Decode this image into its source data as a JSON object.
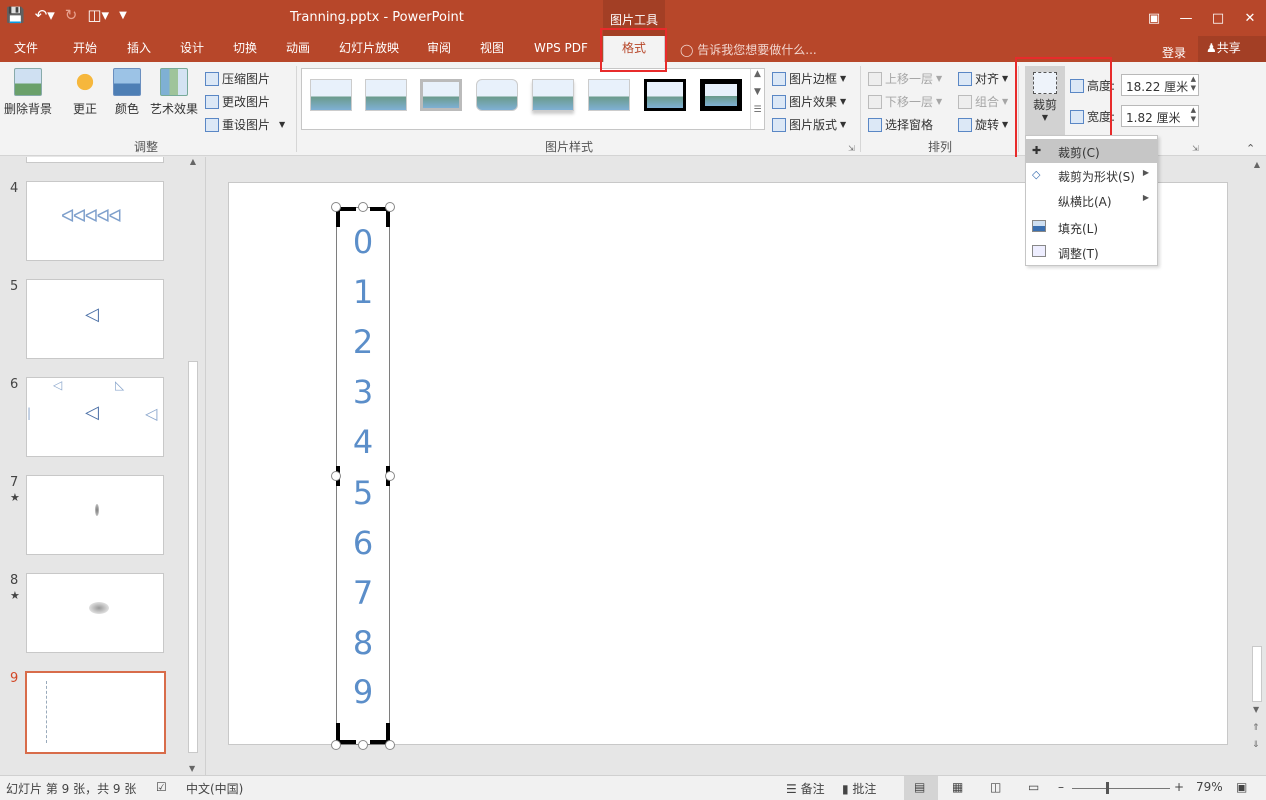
{
  "titlebar": {
    "doc_title": "Tranning.pptx - PowerPoint",
    "context_group": "图片工具",
    "qat_icons": [
      "save-icon",
      "undo-icon",
      "redo-icon",
      "present-icon",
      "customize-icon"
    ],
    "window_controls": [
      "ribbon-display-icon",
      "minimize-icon",
      "maximize-icon",
      "close-icon"
    ]
  },
  "tabs": [
    "文件",
    "开始",
    "插入",
    "设计",
    "切换",
    "动画",
    "幻灯片放映",
    "审阅",
    "视图",
    "WPS PDF",
    "格式"
  ],
  "tell_me": "告诉我您想要做什么...",
  "login": "登录",
  "share": "共享",
  "ribbon": {
    "adjust": {
      "remove_bg": "删除背景",
      "corrections": "更正",
      "color": "颜色",
      "artistic": "艺术效果",
      "compress": "压缩图片",
      "change": "更改图片",
      "reset": "重设图片",
      "label": "调整"
    },
    "styles": {
      "border": "图片边框",
      "effects": "图片效果",
      "layout": "图片版式",
      "label": "图片样式"
    },
    "arrange": {
      "bring_forward": "上移一层",
      "send_backward": "下移一层",
      "selection_pane": "选择窗格",
      "align": "对齐",
      "group": "组合",
      "rotate": "旋转",
      "label": "排列"
    },
    "size": {
      "crop": "裁剪",
      "height_label": "高度:",
      "height_value": "18.22 厘米",
      "width_label": "宽度:",
      "width_value": "1.82 厘米"
    }
  },
  "crop_menu": [
    {
      "label": "裁剪(C)",
      "icon": "crop-icon",
      "submenu": false,
      "highlighted": true
    },
    {
      "label": "裁剪为形状(S)",
      "icon": "crop-shape-icon",
      "submenu": true,
      "highlighted": false
    },
    {
      "label": "纵横比(A)",
      "icon": "",
      "submenu": true,
      "highlighted": false
    },
    {
      "label": "填充(L)",
      "icon": "fill-icon",
      "submenu": false,
      "highlighted": false
    },
    {
      "label": "调整(T)",
      "icon": "fit-icon",
      "submenu": false,
      "highlighted": false
    }
  ],
  "slides": [
    {
      "num": "4",
      "star": false,
      "content": "ᐊᐊᐊᐊᐊ"
    },
    {
      "num": "5",
      "star": false,
      "content": "◁"
    },
    {
      "num": "6",
      "star": false,
      "content": "◁"
    },
    {
      "num": "7",
      "star": true,
      "content": ""
    },
    {
      "num": "8",
      "star": true,
      "content": ""
    },
    {
      "num": "9",
      "star": false,
      "content": ""
    }
  ],
  "picture_digits": [
    "0",
    "1",
    "2",
    "3",
    "4",
    "5",
    "6",
    "7",
    "8",
    "9"
  ],
  "status": {
    "slide_info": "幻灯片 第 9 张，共 9 张",
    "language": "中文(中国)",
    "notes": "备注",
    "comments": "批注",
    "zoom": "79%"
  },
  "colors": {
    "accent": "#b7472a",
    "highlight_box": "#e82b2b",
    "digit_color": "#5b8ec9"
  }
}
